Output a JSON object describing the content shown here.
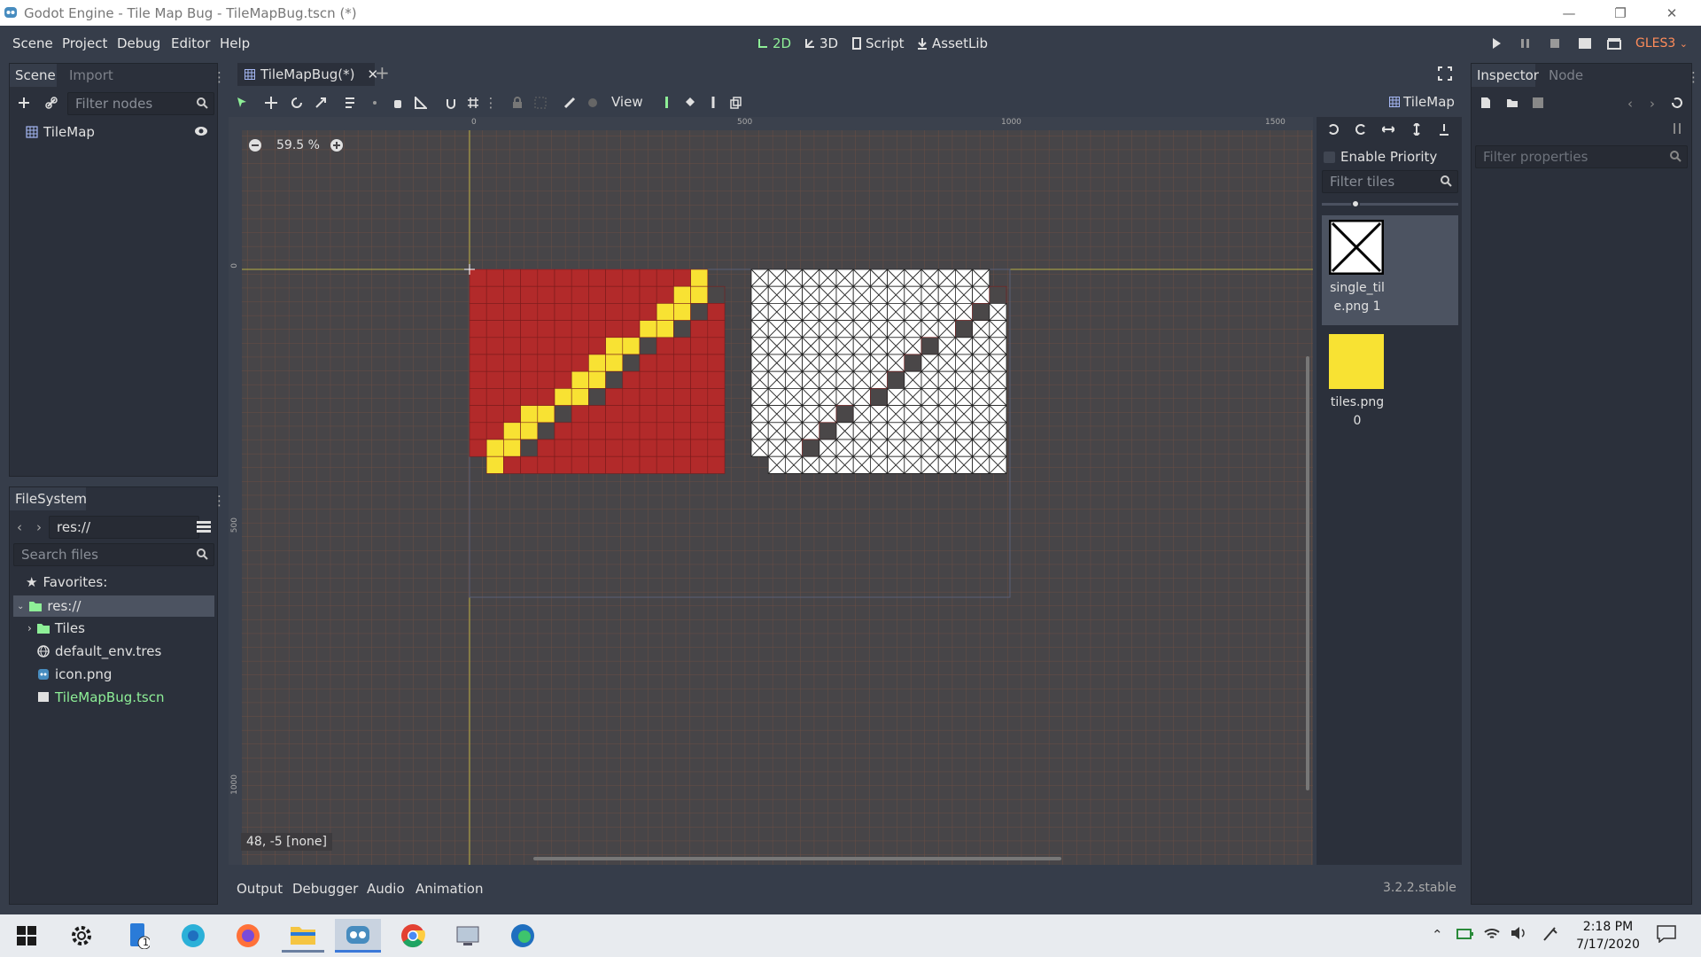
{
  "window": {
    "title": "Godot Engine - Tile Map Bug - TileMapBug.tscn (*)"
  },
  "menu": {
    "items": [
      "Scene",
      "Project",
      "Debug",
      "Editor",
      "Help"
    ]
  },
  "workspaces": {
    "d2": "2D",
    "d3": "3D",
    "script": "Script",
    "assetlib": "AssetLib"
  },
  "renderer": "GLES3",
  "scene_dock": {
    "tab_scene": "Scene",
    "tab_import": "Import",
    "filter_placeholder": "Filter nodes",
    "root_node": "TileMap"
  },
  "filesystem": {
    "tab": "FileSystem",
    "path": "res://",
    "search_placeholder": "Search files",
    "favorites": "Favorites:",
    "items": [
      "res://",
      "Tiles",
      "default_env.tres",
      "icon.png",
      "TileMapBug.tscn"
    ]
  },
  "editor": {
    "scene_tab": "TileMapBug(*)",
    "view_menu": "View",
    "zoom": "59.5 %",
    "status": "48, -5 [none]",
    "ruler_marks": [
      "0",
      "500",
      "1000",
      "1500"
    ],
    "ruler_v_marks": [
      "0",
      "500",
      "1000"
    ],
    "node_label": "TileMap"
  },
  "tile_palette": {
    "enable_priority": "Enable Priority",
    "filter_placeholder": "Filter tiles",
    "tiles": [
      {
        "label": "single_tile.png 1",
        "line1": "single_til",
        "line2": "e.png 1"
      },
      {
        "label": "tiles.png 0",
        "line1": "tiles.png",
        "line2": "0"
      }
    ]
  },
  "bottom_panel": {
    "tabs": [
      "Output",
      "Debugger",
      "Audio",
      "Animation"
    ],
    "version": "3.2.2.stable"
  },
  "inspector": {
    "tab_inspector": "Inspector",
    "tab_node": "Node",
    "filter_placeholder": "Filter properties"
  },
  "taskbar": {
    "time": "2:18 PM",
    "date": "7/17/2020",
    "notification_badge": "1"
  },
  "colors": {
    "accent_green": "#8eef97",
    "tile_red": "#b22a2a",
    "tile_yellow": "#f8e233",
    "grid_line": "#8a4a3a"
  }
}
